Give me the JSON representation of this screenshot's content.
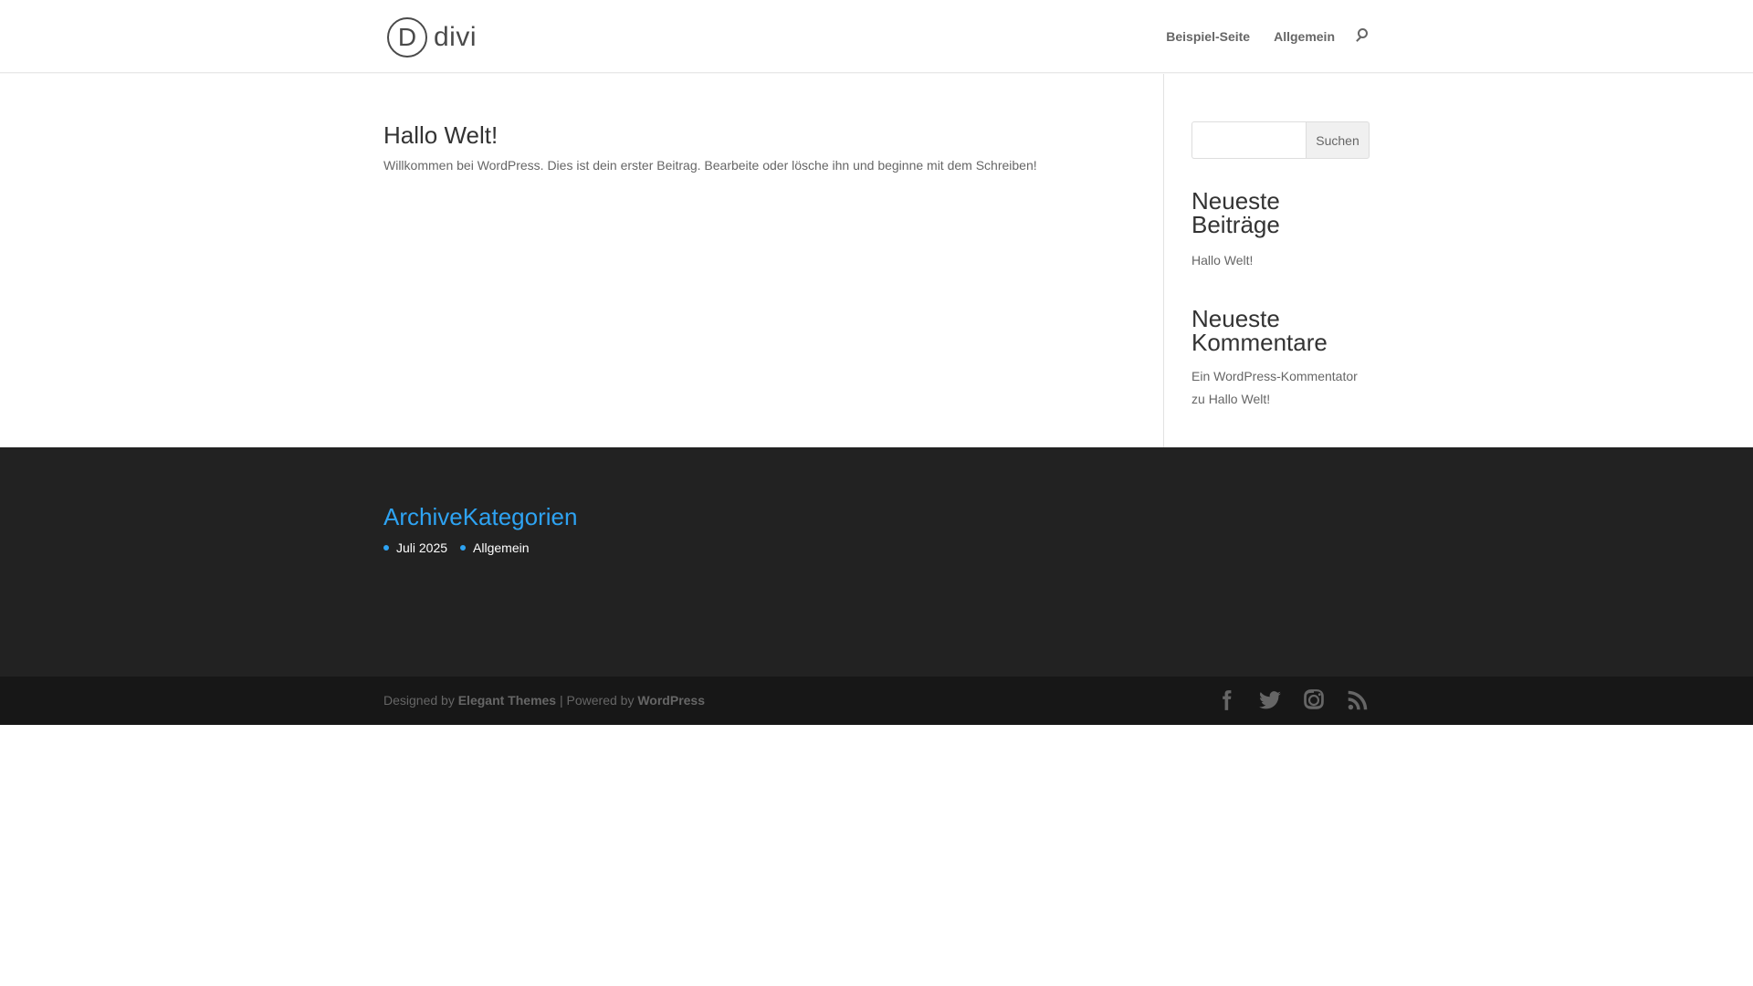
{
  "header": {
    "logo_letter": "D",
    "logo_text": "divi",
    "nav": [
      "Beispiel-Seite",
      "Allgemein"
    ]
  },
  "post": {
    "title": "Hallo Welt!",
    "excerpt": "Willkommen bei WordPress. Dies ist dein erster Beitrag. Bearbeite oder lösche ihn und beginne mit dem Schreiben!"
  },
  "sidebar": {
    "search_button": "Suchen",
    "recent_posts_title_1": "Neueste",
    "recent_posts_title_2": "Beiträge",
    "recent_post": "Hallo Welt!",
    "recent_comments_title_1": "Neueste",
    "recent_comments_title_2": "Kommentare",
    "comment_author": "Ein WordPress-Kommentator",
    "comment_on": "zu",
    "comment_post": "Hallo Welt!"
  },
  "footer": {
    "heading": "ArchiveKategorien",
    "items": [
      "Juli 2025",
      "Allgemein"
    ]
  },
  "bottom": {
    "designed_by": "Designed by",
    "elegant": "Elegant Themes",
    "separator": "| Powered by",
    "wordpress": "WordPress"
  },
  "social_icons": [
    "facebook-icon",
    "twitter-icon",
    "instagram-icon",
    "rss-icon"
  ]
}
